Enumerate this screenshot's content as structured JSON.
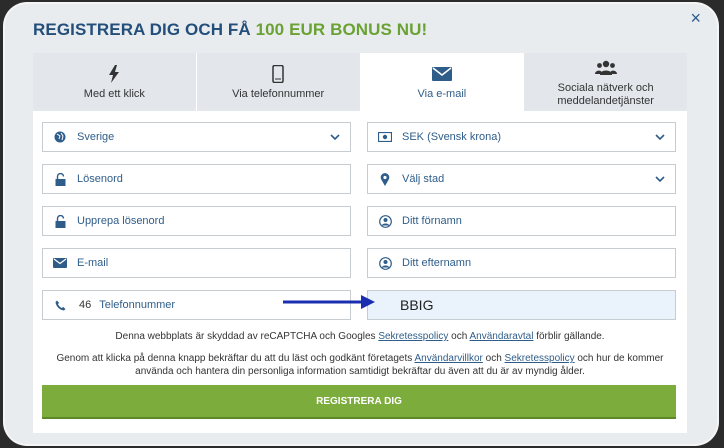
{
  "title": {
    "main": "REGISTRERA DIG OCH FÅ ",
    "highlight": "100 EUR BONUS NU!"
  },
  "close_glyph": "×",
  "tabs": [
    {
      "label": "Med ett klick",
      "icon": "lightning-icon"
    },
    {
      "label": "Via telefonnummer",
      "icon": "phone-icon"
    },
    {
      "label": "Via e-mail",
      "icon": "envelope-icon",
      "active": true
    },
    {
      "label": "Sociala nätverk och meddelandetjänster",
      "icon": "users-icon"
    }
  ],
  "fields": {
    "country": "Sverige",
    "currency": "SEK (Svensk krona)",
    "password": "Lösenord",
    "city": "Välj stad",
    "repeat_password": "Upprepa lösenord",
    "first_name": "Ditt förnamn",
    "email": "E-mail",
    "last_name": "Ditt efternamn",
    "phone_code": "46",
    "phone": "Telefonnummer",
    "promo_code": "BBIG"
  },
  "info": {
    "recaptcha_pre": "Denna webbplats är skyddad av reCAPTCHA och Googles ",
    "privacy_link": "Sekretesspolicy",
    "and": " och ",
    "terms_link": "Användaravtal",
    "recaptcha_post": " förblir gällande.",
    "consent_pre": "Genom att klicka på denna knapp bekräftar du att du läst och godkänt företagets ",
    "conditions_link": "Användarvillkor",
    "consent_and": " och ",
    "consent_privacy_link": "Sekretesspolicy",
    "consent_post": " och hur de kommer använda och hantera din personliga information samtidigt bekräftar du även att du är av myndig ålder."
  },
  "register_button": "REGISTRERA DIG",
  "colors": {
    "accent_green": "#7cac3c",
    "brand_blue": "#234f7a",
    "highlight_green": "#6ba234"
  }
}
